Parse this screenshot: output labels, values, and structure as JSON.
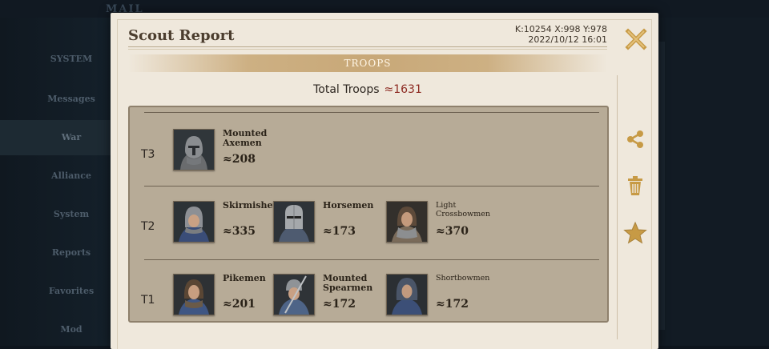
{
  "background": {
    "title": "MAIL",
    "sidebar_items": [
      "SYSTEM",
      "Messages",
      "War",
      "Alliance",
      "System",
      "Reports",
      "Favorites",
      "Mod"
    ]
  },
  "header": {
    "title": "Scout Report",
    "coords": "K:10254 X:998 Y:978",
    "timestamp": "2022/10/12 16:01"
  },
  "section": {
    "label": "TROOPS"
  },
  "total": {
    "label": "Total Troops",
    "value": "≈1631"
  },
  "tiers": [
    {
      "label": "T3",
      "units": [
        {
          "name": "Mounted Axemen",
          "count": "≈208",
          "icon": "helmet-mail-coif"
        }
      ]
    },
    {
      "label": "T2",
      "units": [
        {
          "name": "Skirmishers",
          "count": "≈335",
          "icon": "helmet-open"
        },
        {
          "name": "Horsemen",
          "count": "≈173",
          "icon": "helmet-great"
        },
        {
          "name": "Light Crossbowmen",
          "count": "≈370",
          "icon": "helmet-hood"
        }
      ]
    },
    {
      "label": "T1",
      "units": [
        {
          "name": "Pikemen",
          "count": "≈201",
          "icon": "hood-pikeman"
        },
        {
          "name": "Mounted Spearmen",
          "count": "≈172",
          "icon": "helmet-spear"
        },
        {
          "name": "Shortbowmen",
          "count": "≈172",
          "icon": "hood-archer"
        }
      ]
    }
  ],
  "actions": [
    "share-icon",
    "trash-icon",
    "star-icon"
  ],
  "colors": {
    "panel": "#efe8dc",
    "troop_box": "#b7ab97",
    "accent_gold": "#c8a25a",
    "total_value": "#8d2a22"
  }
}
